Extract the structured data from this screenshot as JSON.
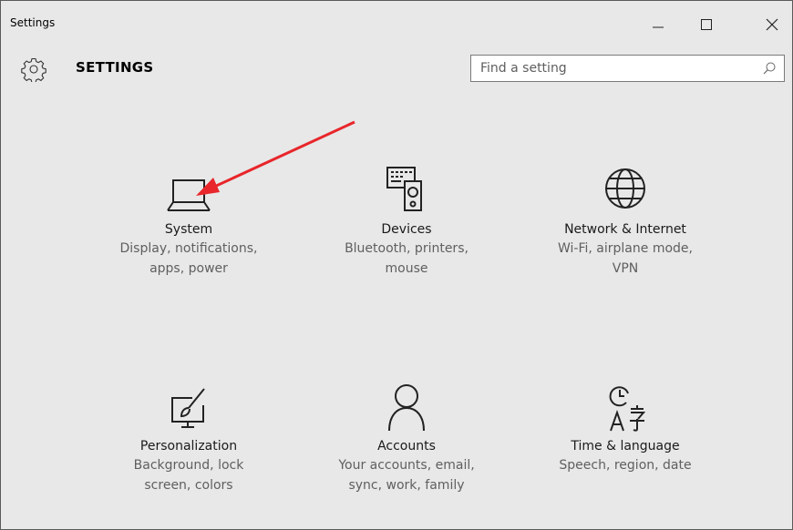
{
  "window": {
    "title": "Settings",
    "controls": [
      "minimize",
      "maximize",
      "close"
    ]
  },
  "header": {
    "heading": "SETTINGS",
    "icon": "gear-icon",
    "search_placeholder": "Find a setting",
    "search_value": ""
  },
  "tiles": [
    {
      "label": "System",
      "desc1": "Display, notifications,",
      "desc2": "apps, power",
      "icon": "laptop-icon"
    },
    {
      "label": "Devices",
      "desc1": "Bluetooth, printers,",
      "desc2": "mouse",
      "icon": "keyboard-speaker-icon"
    },
    {
      "label": "Network & Internet",
      "desc1": "Wi-Fi, airplane mode,",
      "desc2": "VPN",
      "icon": "globe-icon"
    },
    {
      "label": "Personalization",
      "desc1": "Background, lock",
      "desc2": "screen, colors",
      "icon": "paint-brush-icon"
    },
    {
      "label": "Accounts",
      "desc1": "Your accounts, email,",
      "desc2": "sync, work, family",
      "icon": "person-icon"
    },
    {
      "label": "Time & language",
      "desc1": "Speech, region, date",
      "desc2": "",
      "icon": "time-language-icon"
    }
  ],
  "annotation": {
    "color": "#e8262b",
    "icon": "red-arrow-pointing-to-system"
  }
}
